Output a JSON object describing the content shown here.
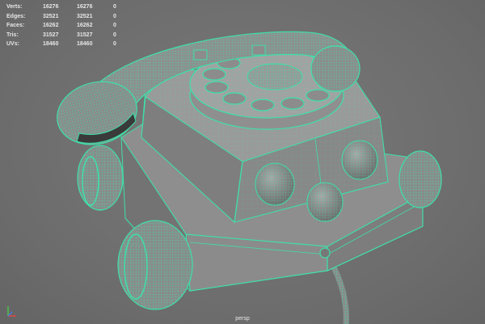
{
  "hud": {
    "rows": [
      {
        "label": "Verts:",
        "v1": "16276",
        "v2": "16276",
        "v3": "0"
      },
      {
        "label": "Edges:",
        "v1": "32521",
        "v2": "32521",
        "v3": "0"
      },
      {
        "label": "Faces:",
        "v1": "16262",
        "v2": "16262",
        "v3": "0"
      },
      {
        "label": "Tris:",
        "v1": "31527",
        "v2": "31527",
        "v3": "0"
      },
      {
        "label": "UVs:",
        "v1": "18460",
        "v2": "18460",
        "v3": "0"
      }
    ]
  },
  "camera": {
    "name": "persp"
  },
  "colors": {
    "wire": "#3fe0a8",
    "shade": "#8c8c8c",
    "bg": "#6f6f6f"
  },
  "icons": {
    "axis": "axis-gizmo-icon"
  }
}
